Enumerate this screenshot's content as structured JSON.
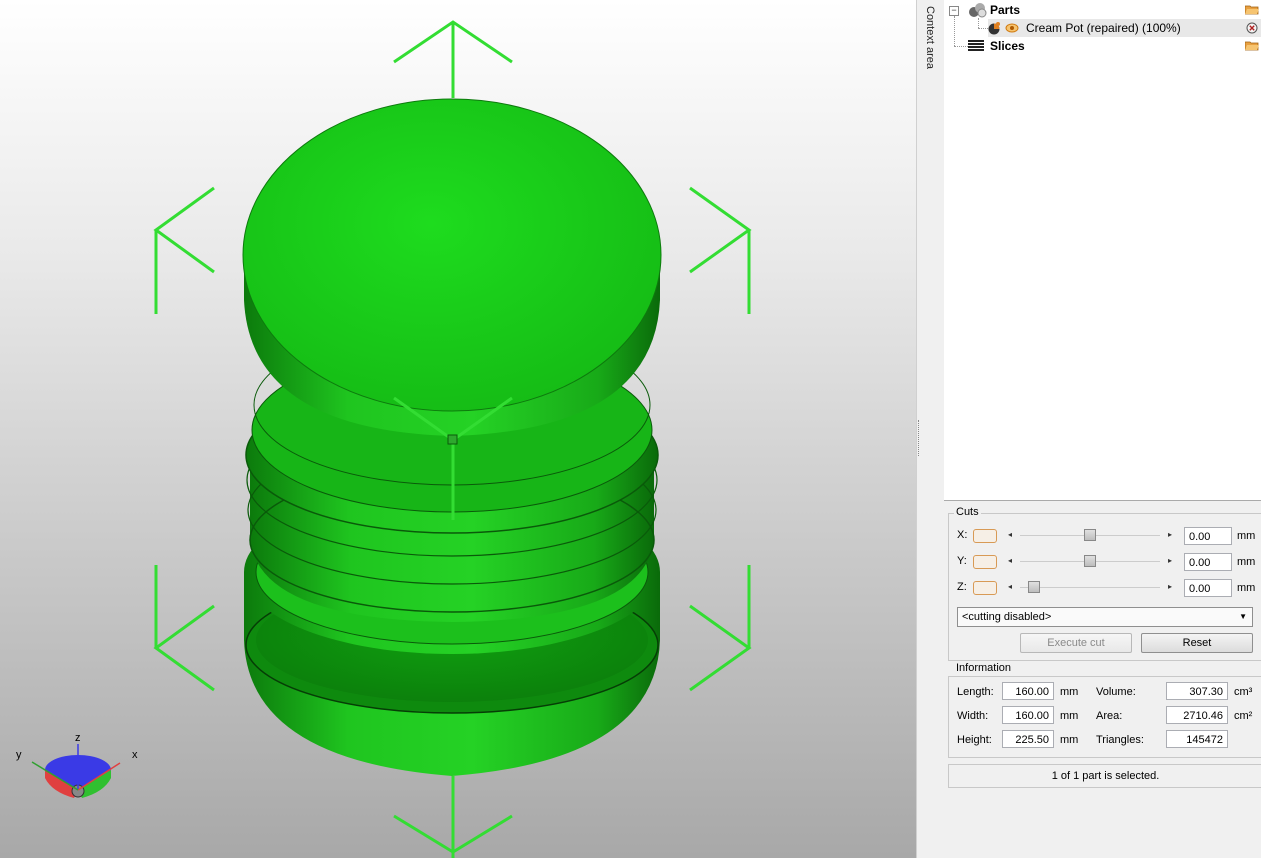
{
  "viewport": {
    "model_color": "#1ecf1e",
    "gizmo_color": "#33dd33",
    "axis_labels": {
      "x": "x",
      "y": "y",
      "z": "z"
    }
  },
  "context_tab": {
    "label": "Context area"
  },
  "tree": {
    "parts": {
      "label": "Parts",
      "expander": "−"
    },
    "part_item": {
      "label": "Cream Pot (repaired) (100%)"
    },
    "slices": {
      "label": "Slices"
    }
  },
  "cuts": {
    "title": "Cuts",
    "axes": [
      {
        "label": "X:",
        "value": "0.00",
        "unit": "mm",
        "position": 0.5
      },
      {
        "label": "Y:",
        "value": "0.00",
        "unit": "mm",
        "position": 0.5
      },
      {
        "label": "Z:",
        "value": "0.00",
        "unit": "mm",
        "position": 0.06
      }
    ],
    "mode_select": "<cutting disabled>",
    "execute_label": "Execute cut",
    "reset_label": "Reset"
  },
  "information": {
    "title": "Information",
    "length_label": "Length:",
    "length_value": "160.00",
    "length_unit": "mm",
    "width_label": "Width:",
    "width_value": "160.00",
    "width_unit": "mm",
    "height_label": "Height:",
    "height_value": "225.50",
    "height_unit": "mm",
    "volume_label": "Volume:",
    "volume_value": "307.30",
    "volume_unit": "cm³",
    "area_label": "Area:",
    "area_value": "2710.46",
    "area_unit": "cm²",
    "triangles_label": "Triangles:",
    "triangles_value": "145472"
  },
  "status": {
    "text": "1 of 1 part is selected."
  }
}
